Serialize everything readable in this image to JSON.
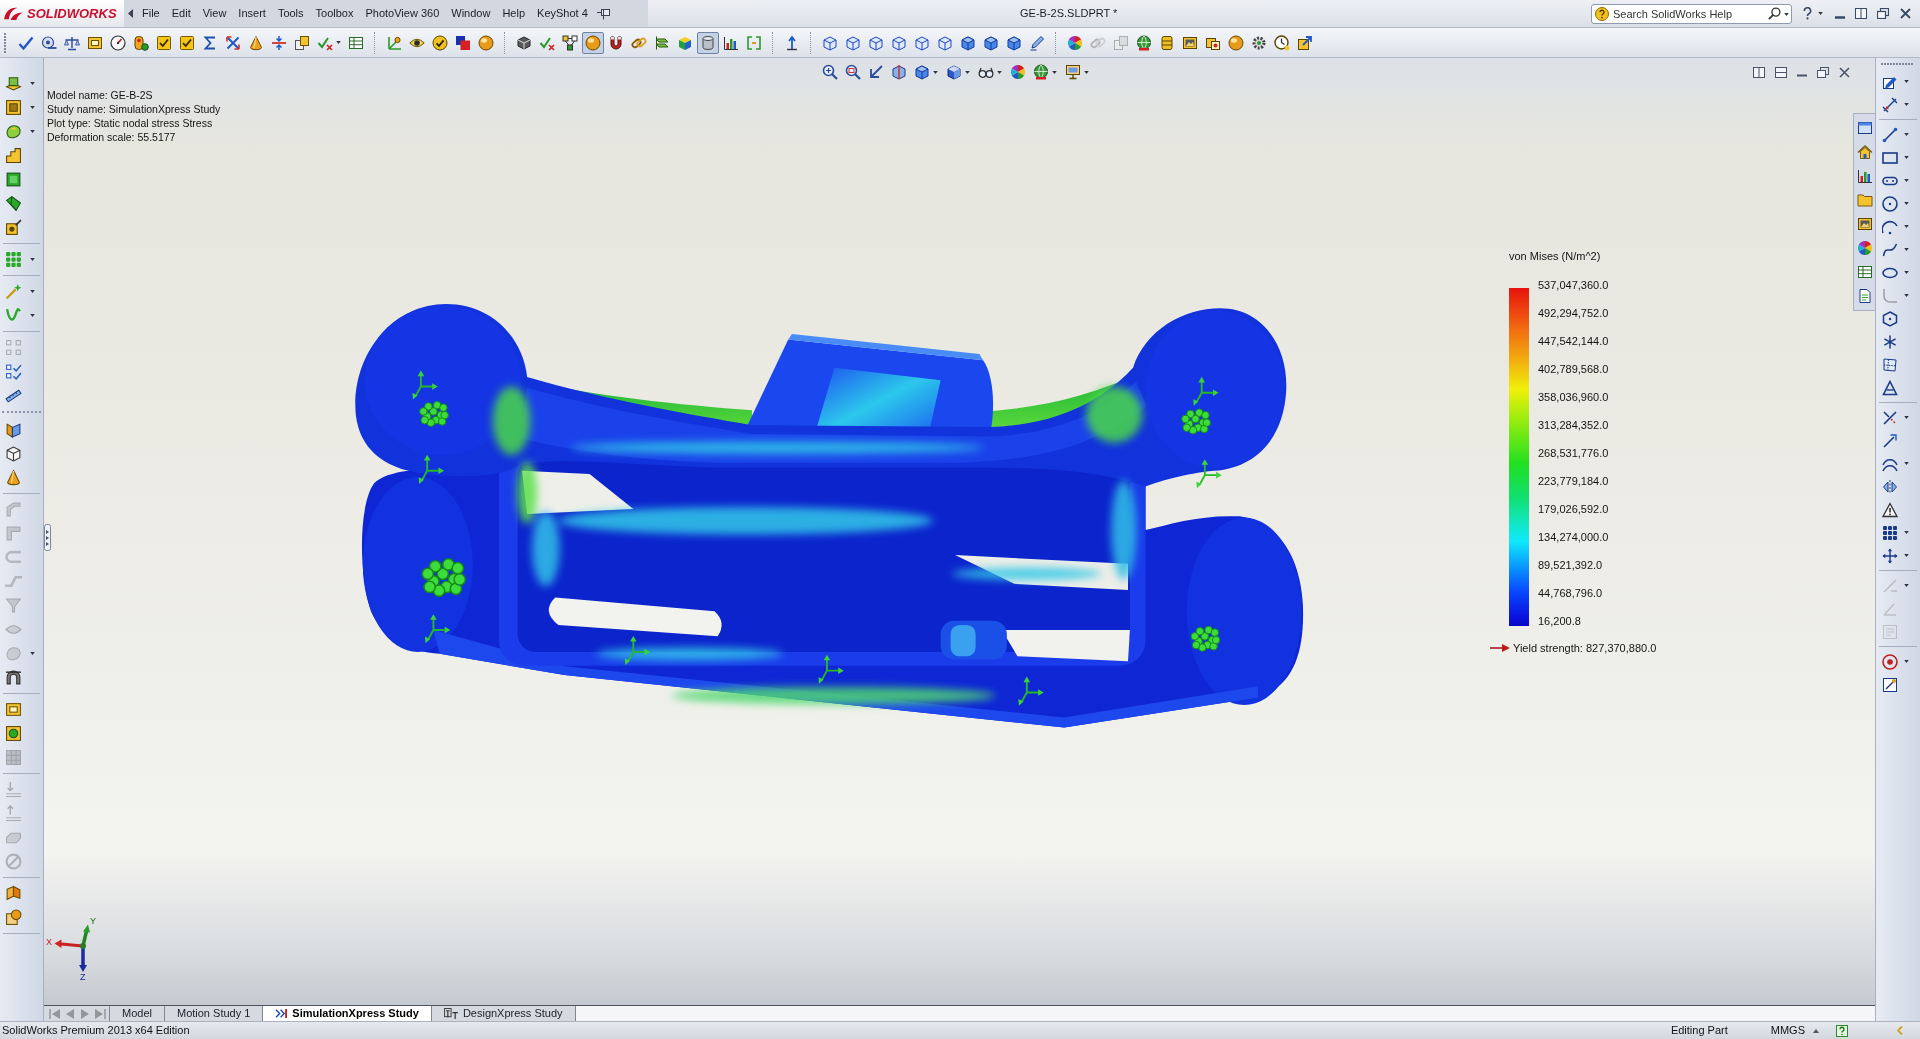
{
  "title_bar": {
    "logo_text": "SOLIDWORKS",
    "menu": [
      "File",
      "Edit",
      "View",
      "Insert",
      "Tools",
      "Toolbox",
      "PhotoView 360",
      "Window",
      "Help",
      "KeyShot 4"
    ],
    "document_title": "GE-B-2S.SLDPRT *",
    "search": {
      "placeholder": "Search SolidWorks Help"
    }
  },
  "command_toolbar": [
    {
      "pressed": false,
      "disabled": false
    },
    {
      "pressed": false,
      "disabled": false
    },
    {
      "pressed": false,
      "disabled": false
    },
    {
      "pressed": false,
      "disabled": false
    },
    {
      "pressed": false,
      "disabled": false
    },
    {
      "pressed": false,
      "disabled": false
    },
    {
      "pressed": false,
      "disabled": false
    },
    {
      "pressed": false,
      "disabled": false
    },
    {
      "pressed": false,
      "disabled": false
    },
    {
      "pressed": false,
      "disabled": false
    },
    {
      "pressed": false,
      "disabled": false
    },
    {
      "pressed": false,
      "disabled": false
    },
    {
      "pressed": false,
      "disabled": false
    },
    {
      "pressed": false,
      "disabled": false
    },
    {
      "pressed": false,
      "disabled": false
    },
    {
      "pressed": false,
      "disabled": false
    },
    {
      "pressed": false,
      "disabled": false
    },
    {
      "pressed": false,
      "disabled": false
    },
    {
      "pressed": false,
      "disabled": false
    },
    {
      "pressed": false,
      "disabled": false
    },
    {
      "pressed": false,
      "disabled": false
    },
    {
      "pressed": false,
      "disabled": false
    },
    {
      "pressed": false,
      "disabled": false
    },
    {
      "pressed": true,
      "disabled": false
    },
    {
      "pressed": false,
      "disabled": false
    },
    {
      "pressed": false,
      "disabled": false
    },
    {
      "pressed": false,
      "disabled": false
    },
    {
      "pressed": false,
      "disabled": false
    },
    {
      "pressed": true,
      "disabled": false
    },
    {
      "pressed": false,
      "disabled": false
    },
    {
      "pressed": false,
      "disabled": false
    },
    {
      "pressed": false,
      "disabled": false
    },
    {
      "pressed": false,
      "disabled": false
    },
    {
      "pressed": false,
      "disabled": false
    },
    {
      "pressed": false,
      "disabled": false
    },
    {
      "pressed": false,
      "disabled": false
    },
    {
      "pressed": false,
      "disabled": false
    },
    {
      "pressed": false,
      "disabled": false
    },
    {
      "pressed": false,
      "disabled": false
    },
    {
      "pressed": false,
      "disabled": false
    },
    {
      "pressed": false,
      "disabled": false
    },
    {
      "pressed": false,
      "disabled": false
    },
    {
      "pressed": false,
      "disabled": false
    },
    {
      "pressed": false,
      "disabled": true
    },
    {
      "pressed": false,
      "disabled": true
    },
    {
      "pressed": false,
      "disabled": false
    },
    {
      "pressed": false,
      "disabled": false
    },
    {
      "pressed": false,
      "disabled": false
    },
    {
      "pressed": false,
      "disabled": false
    },
    {
      "pressed": false,
      "disabled": false
    },
    {
      "pressed": false,
      "disabled": false
    },
    {
      "pressed": false,
      "disabled": false
    },
    {
      "pressed": false,
      "disabled": false
    }
  ],
  "feature_toolbar": [
    {
      "disabled": false
    },
    {
      "disabled": false
    },
    {
      "disabled": false
    },
    {
      "disabled": false
    },
    {
      "disabled": false
    },
    {
      "disabled": false
    },
    {
      "disabled": false
    },
    {
      "disabled": false
    },
    {
      "disabled": false
    },
    {
      "disabled": false
    },
    {
      "disabled": true
    },
    {
      "disabled": false
    },
    {
      "disabled": false
    },
    {
      "disabled": false
    },
    {
      "disabled": false
    },
    {
      "disabled": false
    },
    {
      "disabled": true
    },
    {
      "disabled": true
    },
    {
      "disabled": true
    },
    {
      "disabled": true
    },
    {
      "disabled": true
    },
    {
      "disabled": true
    },
    {
      "disabled": true
    },
    {
      "disabled": false
    },
    {
      "disabled": false
    },
    {
      "disabled": false
    },
    {
      "disabled": true
    },
    {
      "disabled": true
    },
    {
      "disabled": true
    },
    {
      "disabled": true
    },
    {
      "disabled": true
    },
    {
      "disabled": false
    },
    {
      "disabled": false
    }
  ],
  "sketch_toolbar": [
    {
      "disabled": false
    },
    {
      "disabled": false
    },
    {
      "disabled": false
    },
    {
      "disabled": false
    },
    {
      "disabled": false
    },
    {
      "disabled": false
    },
    {
      "disabled": false
    },
    {
      "disabled": false
    },
    {
      "disabled": false
    },
    {
      "disabled": true
    },
    {
      "disabled": false
    },
    {
      "disabled": false
    },
    {
      "disabled": false
    },
    {
      "disabled": false
    },
    {
      "disabled": false
    },
    {
      "disabled": false
    },
    {
      "disabled": false
    },
    {
      "disabled": false
    },
    {
      "disabled": false
    },
    {
      "disabled": false
    },
    {
      "disabled": false
    },
    {
      "disabled": true
    },
    {
      "disabled": true
    },
    {
      "disabled": true
    },
    {
      "disabled": false
    },
    {
      "disabled": false
    }
  ],
  "viewport": {
    "info": [
      "Model name: GE-B-2S",
      "Study name: SimulationXpress Study",
      "Plot type: Static nodal stress Stress",
      "Deformation scale: 55.5177"
    ],
    "legend": {
      "title": "von Mises (N/m^2)",
      "labels": [
        "537,047,360.0",
        "492,294,752.0",
        "447,542,144.0",
        "402,789,568.0",
        "358,036,960.0",
        "313,284,352.0",
        "268,531,776.0",
        "223,779,184.0",
        "179,026,592.0",
        "134,274,000.0",
        "89,521,392.0",
        "44,768,796.0",
        "16,200.8"
      ],
      "yield_strength": "Yield strength: 827,370,880.0"
    },
    "triad": {
      "x": "X",
      "y": "Y",
      "z": "Z"
    }
  },
  "tab_navigation": {
    "disabled": true
  },
  "study_tabs": [
    {
      "label": "Model",
      "selected": false,
      "kind": "plain"
    },
    {
      "label": "Motion Study 1",
      "selected": false,
      "kind": "plain"
    },
    {
      "label": "SimulationXpress Study",
      "selected": true,
      "kind": "simulation"
    },
    {
      "label": "DesignXpress Study",
      "selected": false,
      "kind": "design"
    }
  ],
  "status_bar": {
    "edition": "SolidWorks Premium 2013 x64 Edition",
    "mode": "Editing Part",
    "units": "MMGS"
  }
}
